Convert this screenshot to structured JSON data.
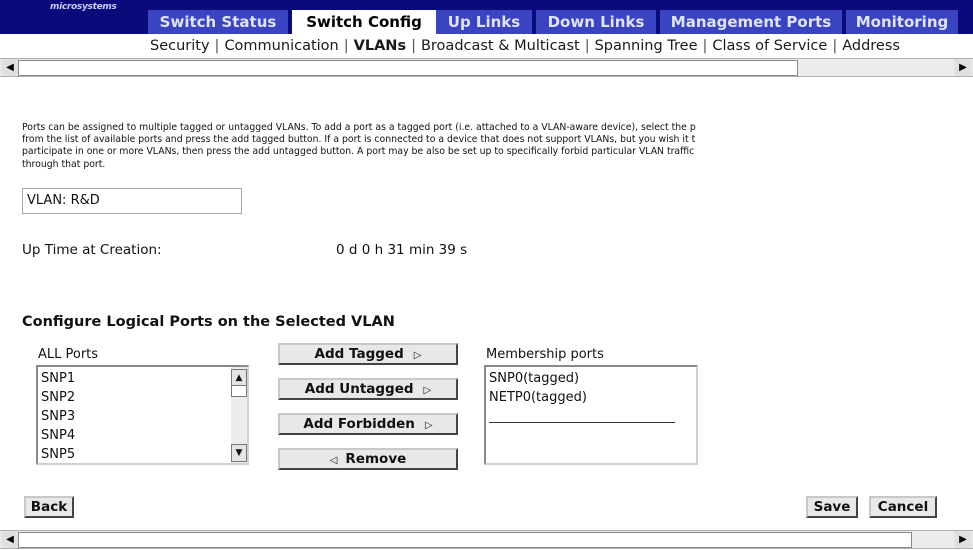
{
  "brand": {
    "logo_text": "microsystems"
  },
  "tabs": [
    {
      "label": "Switch Status",
      "active": false
    },
    {
      "label": "Switch Config",
      "active": true
    },
    {
      "label": "Up Links",
      "active": false
    },
    {
      "label": "Down Links",
      "active": false
    },
    {
      "label": "Management Ports",
      "active": false
    },
    {
      "label": "Monitoring",
      "active": false
    }
  ],
  "subnav": {
    "items": [
      "Security",
      "Communication",
      "VLANs",
      "Broadcast & Multicast",
      "Spanning Tree",
      "Class of Service",
      "Address"
    ],
    "current": "VLANs",
    "separator": "|"
  },
  "description_lines": [
    "Ports can be assigned to multiple tagged or untagged VLANs. To add a port as a tagged port (i.e. attached to a VLAN-aware device), select the p",
    "from the list of available ports and press the add tagged button. If a port is connected to a device that does not support VLANs, but you wish it t",
    "participate in one or more VLANs, then press the add untagged button. A port may be also be set up to specifically forbid particular VLAN traffic",
    "through that port."
  ],
  "vlan_field": {
    "value": "VLAN: R&D"
  },
  "uptime": {
    "label": "Up Time at Creation:",
    "value": "0 d 0 h 31 min 39 s"
  },
  "section_title": "Configure Logical Ports on the Selected VLAN",
  "all_ports": {
    "label": "ALL Ports",
    "items": [
      "SNP1",
      "SNP2",
      "SNP3",
      "SNP4",
      "SNP5"
    ]
  },
  "controls": {
    "add_tagged": "Add Tagged",
    "add_untagged": "Add Untagged",
    "add_forbidden": "Add Forbidden",
    "remove": "Remove"
  },
  "membership": {
    "label": "Membership ports",
    "items": [
      "SNP0(tagged)",
      "NETP0(tagged)"
    ]
  },
  "actions": {
    "back": "Back",
    "save": "Save",
    "cancel": "Cancel"
  },
  "icons": {
    "right_arrow": "right-arrow-icon",
    "left_arrow": "left-arrow-icon"
  },
  "colors": {
    "topbar": "#0a0a7a",
    "tab": "#3a44c0",
    "tab_text": "#dfe3ff"
  }
}
